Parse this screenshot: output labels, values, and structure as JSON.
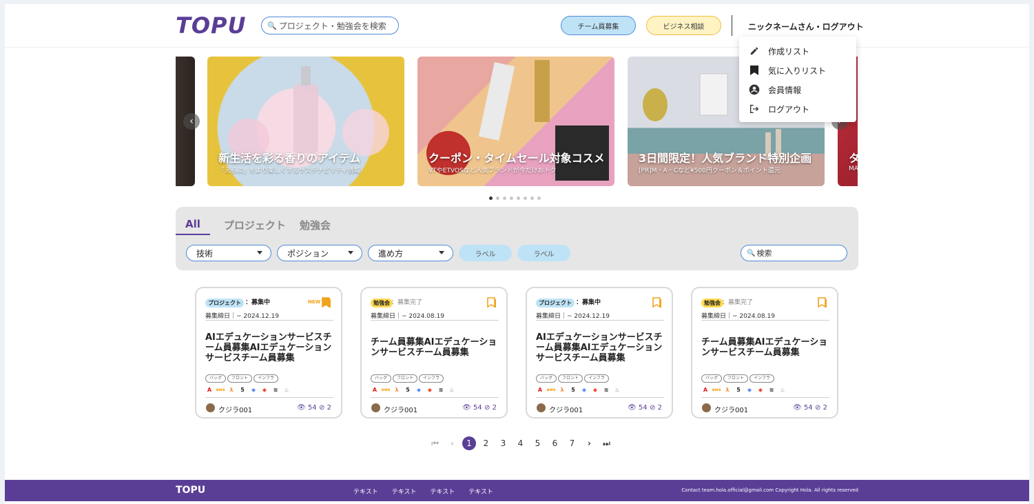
{
  "header": {
    "logo": "TOPU",
    "search_placeholder": "プロジェクト・勉強会を検索",
    "recruit_button": "チーム員募集",
    "business_button": "ビジネス相談",
    "user_link": "ニックネームさん・ログアウト"
  },
  "user_menu": {
    "items": [
      {
        "label": "作成リスト",
        "icon": "pencil-icon"
      },
      {
        "label": "気に入りリスト",
        "icon": "bookmark-icon"
      },
      {
        "label": "会員情報",
        "icon": "account-circle-icon"
      },
      {
        "label": "ログアウト",
        "icon": "logout-icon"
      }
    ]
  },
  "carousel": {
    "slides": [
      {
        "title": "新生活を彩る香りのアイテム",
        "subtitle": "「えらぶ」をより楽しくするサステナビリティ情報"
      },
      {
        "title": "クーポン・タイムセール対象コスメ",
        "subtitle": "VTやETVOSなど人気ブランドが今だけおトク"
      },
      {
        "title": "3日間限定！人気ブランド特別企画",
        "subtitle": "[PR]M・A・Cなど¥500円クーポン＆ポイント還元"
      },
      {
        "title": "タ",
        "subtitle": "MA"
      }
    ],
    "dot_count": 8,
    "active_dot": 0
  },
  "filter": {
    "tabs": [
      "All",
      "プロジェクト",
      "勉強会"
    ],
    "active_tab": "All",
    "selects": [
      "技術",
      "ポジション",
      "進め方"
    ],
    "labels": [
      "ラベル",
      "ラベル"
    ],
    "search_placeholder": "検索"
  },
  "cards": [
    {
      "type": "プロジェクト",
      "status": "：募集中",
      "open": true,
      "new": "NEW",
      "deadline": "募集締日｜~ 2024.12.19",
      "title": "AIエデュケーションサービスチーム員募集AIエデュケーションサービスチーム員募集",
      "tags": [
        "バッグ",
        "フロント",
        "インフラ"
      ],
      "author": "クジラ001",
      "views": "54",
      "likes": "2"
    },
    {
      "type": "勉強会",
      "status": "：募集完了",
      "open": false,
      "new": "",
      "deadline": "募集締日｜~ 2024.08.19",
      "title": "チーム員募集AIエデュケーションサービスチーム員募集",
      "tags": [
        "バッグ",
        "フロント",
        "インフラ"
      ],
      "author": "クジラ001",
      "views": "54",
      "likes": "2"
    },
    {
      "type": "プロジェクト",
      "status": "：募集中",
      "open": true,
      "new": "",
      "deadline": "募集締日｜~ 2024.12.19",
      "title": "AIエデュケーションサービスチーム員募集AIエデュケーションサービスチーム員募集",
      "tags": [
        "バッグ",
        "フロント",
        "インフラ"
      ],
      "author": "クジラ001",
      "views": "54",
      "likes": "2"
    },
    {
      "type": "勉強会",
      "status": "：募集完了",
      "open": false,
      "new": "",
      "deadline": "募集締日｜~ 2024.08.19",
      "title": "チーム員募集AIエデュケーションサービスチーム員募集",
      "tags": [
        "バッグ",
        "フロント",
        "インフラ"
      ],
      "author": "クジラ001",
      "views": "54",
      "likes": "2"
    }
  ],
  "pagination": {
    "pages": [
      "1",
      "2",
      "3",
      "4",
      "5",
      "6",
      "7"
    ],
    "current": "1"
  },
  "footer": {
    "logo": "TOPU",
    "links": [
      "テキスト",
      "テキスト",
      "テキスト",
      "テキスト"
    ],
    "copyright": "Contact team.hola.official@gmail.com Copyright Hola. All rights reserved"
  },
  "colors": {
    "brand": "#5a3e96",
    "accent_blue": "#4d8ad8",
    "bookmark": "#f1a31c"
  }
}
